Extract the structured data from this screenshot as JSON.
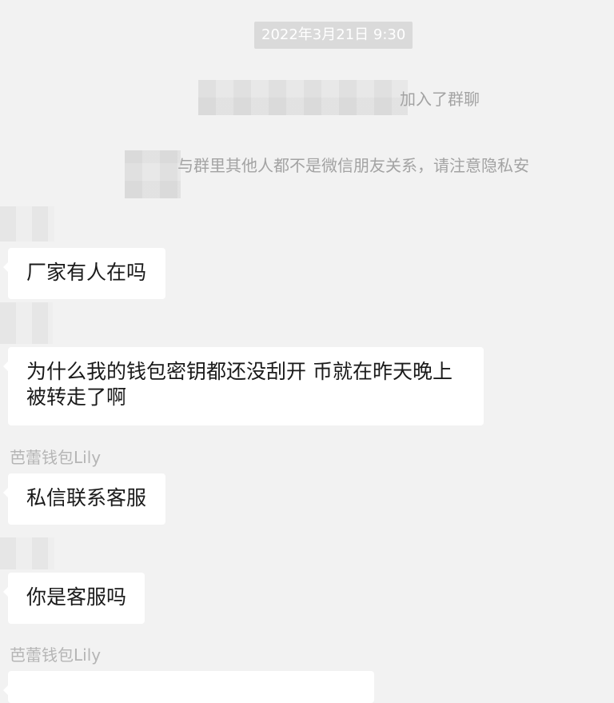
{
  "timestamp": "2022年3月21日 9:30",
  "system_messages": {
    "joined_suffix": "加入了群聊",
    "privacy_notice": "与群里其他人都不是微信朋友关系，请注意隐私安"
  },
  "messages": [
    {
      "sender": "",
      "text": "厂家有人在吗"
    },
    {
      "sender": "",
      "text_line1": "为什么我的钱包密钥都还没刮开 币就在昨天晚上",
      "text_line2": "被转走了啊"
    },
    {
      "sender": "芭蕾钱包Lily",
      "text": "私信联系客服"
    },
    {
      "sender": "",
      "text": "你是客服吗"
    },
    {
      "sender": "芭蕾钱包Lily",
      "text": ""
    }
  ]
}
